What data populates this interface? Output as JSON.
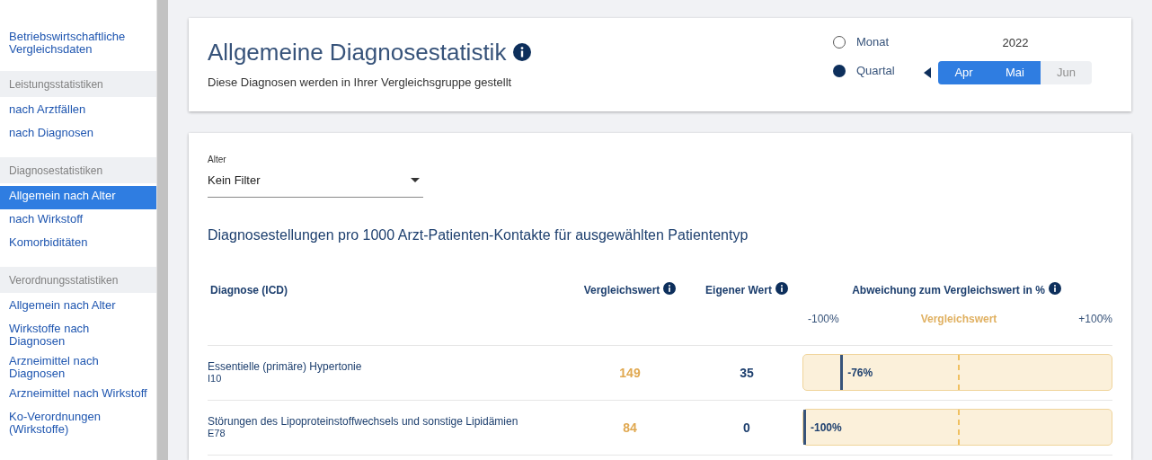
{
  "sidebar": {
    "top_link": "Betriebswirtschaftliche Vergleichsdaten",
    "groups": [
      {
        "title": "Leistungsstatistiken",
        "items": [
          {
            "label": "nach Arztfällen",
            "selected": false
          },
          {
            "label": "nach Diagnosen",
            "selected": false
          }
        ]
      },
      {
        "title": "Diagnosestatistiken",
        "items": [
          {
            "label": "Allgemein nach Alter",
            "selected": true
          },
          {
            "label": "nach Wirkstoff",
            "selected": false
          },
          {
            "label": "Komorbiditäten",
            "selected": false
          }
        ]
      },
      {
        "title": "Verordnungsstatistiken",
        "items": [
          {
            "label": "Allgemein nach Alter",
            "selected": false
          },
          {
            "label": "Wirkstoffe nach Diagnosen",
            "selected": false
          },
          {
            "label": "Arzneimittel nach Diagnosen",
            "selected": false
          },
          {
            "label": "Arzneimittel nach Wirkstoff",
            "selected": false
          },
          {
            "label": "Ko-Verordnungen (Wirkstoffe)",
            "selected": false
          }
        ]
      }
    ]
  },
  "header": {
    "title": "Allgemeine Diagnosestatistik",
    "subtitle": "Diese Diagnosen werden in Ihrer Vergleichsgruppe gestellt",
    "period_options": [
      {
        "label": "Monat",
        "selected": false
      },
      {
        "label": "Quartal",
        "selected": true
      }
    ],
    "year": "2022",
    "months": [
      {
        "label": "Apr",
        "selected": true
      },
      {
        "label": "Mai",
        "selected": true
      },
      {
        "label": "Jun",
        "selected": false
      }
    ]
  },
  "filter": {
    "label": "Alter",
    "value": "Kein Filter"
  },
  "table": {
    "title": "Diagnosestellungen pro 1000 Arzt-Patienten-Kontakte für ausgewählten Patiententyp",
    "columns": [
      "Diagnose (ICD)",
      "Vergleichswert",
      "Eigener Wert",
      "Abweichung zum Vergleichswert in %"
    ],
    "scale": {
      "min": "-100%",
      "center": "Vergleichswert",
      "max": "+100%"
    },
    "rows": [
      {
        "diagnosis": "Essentielle (primäre) Hypertonie",
        "code": "I10",
        "reference": "149",
        "own": "35",
        "deviation": "-76%",
        "level": 0.12
      },
      {
        "diagnosis": "Störungen des Lipoproteinstoffwechsels und sonstige Lipidämien",
        "code": "E78",
        "reference": "84",
        "own": "0",
        "deviation": "-100%",
        "level": 0
      }
    ]
  }
}
